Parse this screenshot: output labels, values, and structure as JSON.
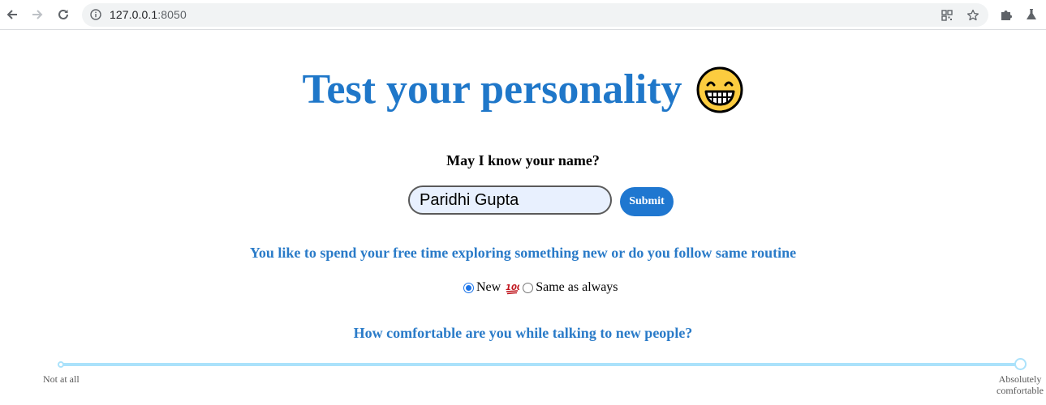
{
  "browser": {
    "url_host": "127.0.0.1",
    "url_port": ":8050",
    "icons": [
      "back-arrow-icon",
      "forward-arrow-icon",
      "reload-icon",
      "info-icon",
      "qr-code-icon",
      "star-icon",
      "extensions-puzzle-icon",
      "labs-flask-icon"
    ]
  },
  "page": {
    "title": "Test your personality",
    "title_emoji": "grinning-face-icon",
    "accent_color": "#1f77c9",
    "name_label": "May I know your name?",
    "name_input_value": "Paridhi Gupta",
    "submit_label": "Submit",
    "question1": "You like to spend your free time exploring something new or do you follow same routine",
    "radio_options": [
      {
        "label": "New",
        "checked": true
      },
      {
        "label": "Same as always",
        "checked": false
      }
    ],
    "radio_emoji": "hundred-points-icon",
    "question2": "How comfortable are you while talking to new people?",
    "slider": {
      "min_label": "Not at all",
      "max_label_line1": "Absolutely",
      "max_label_line2": "comfortable",
      "value_fraction": 1.0
    }
  }
}
